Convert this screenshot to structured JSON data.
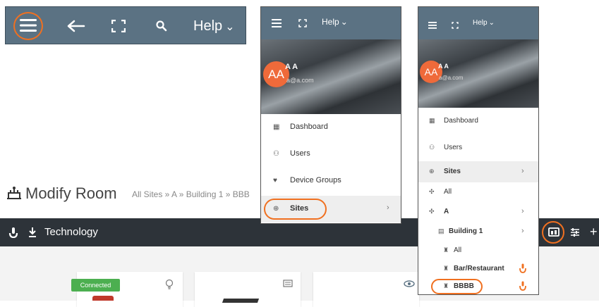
{
  "panel1": {
    "icons": [
      "hamburger-icon",
      "back-arrow-icon",
      "fullscreen-icon",
      "search-icon"
    ],
    "help_label": "Help",
    "help_caret": "⌄"
  },
  "panel2": {
    "help_label": "Help",
    "help_caret": "⌄",
    "avatar_initials": "AA",
    "user_name": "A A",
    "user_email": "a@a.com",
    "menu": [
      {
        "label": "Dashboard",
        "icon": "dashboard-icon"
      },
      {
        "label": "Users",
        "icon": "users-icon"
      },
      {
        "label": "Device Groups",
        "icon": "device-groups-icon"
      },
      {
        "label": "Sites",
        "icon": "sites-icon",
        "chevron": "›"
      }
    ]
  },
  "panel3": {
    "help_label": "Help",
    "help_caret": "⌄",
    "avatar_initials": "AA",
    "user_name": "A A",
    "user_email": "a@a.com",
    "menu": [
      {
        "label": "Dashboard",
        "icon": "dashboard-icon"
      },
      {
        "label": "Users",
        "icon": "users-icon"
      },
      {
        "label": "Sites",
        "icon": "sites-icon",
        "chevron": "›"
      },
      {
        "label": "All",
        "icon": "all-sites-icon"
      },
      {
        "label": "A",
        "icon": "site-a-icon",
        "chevron": "›"
      },
      {
        "label": "Building 1",
        "icon": "building-icon",
        "chevron": "›"
      },
      {
        "label": "All",
        "icon": "room-icon"
      },
      {
        "label": "Bar/Restaurant",
        "icon": "room-icon"
      },
      {
        "label": "BBBB",
        "icon": "room-icon"
      }
    ]
  },
  "bottom": {
    "page_title": "Modify Room",
    "breadcrumb": "All Sites » A » Building 1 » BBB",
    "toolbar_label": "Technology",
    "status_badge": "Connected",
    "plus_label": "+"
  },
  "colors": {
    "accent": "#f07020",
    "header": "#5b7283",
    "dark_bar": "#2d3339",
    "avatar": "#ef6a3a",
    "connected": "#4caf50"
  }
}
